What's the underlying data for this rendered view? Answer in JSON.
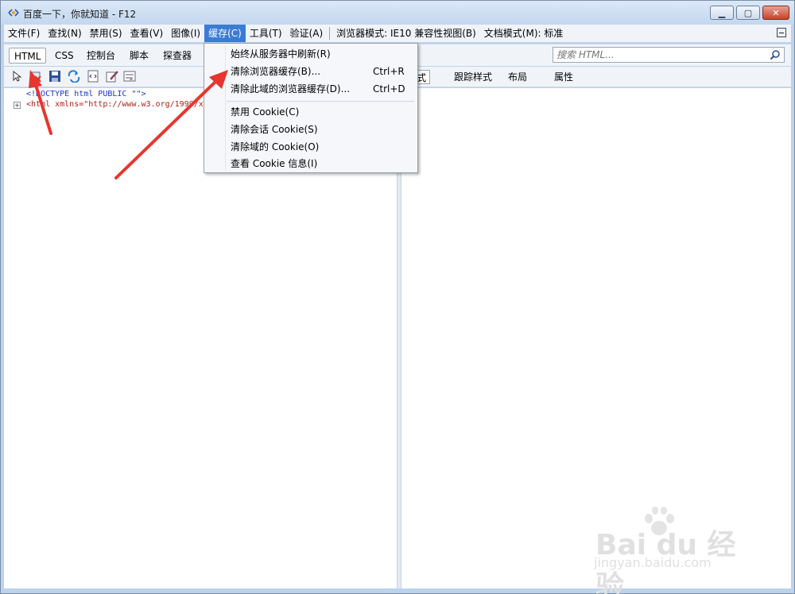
{
  "window": {
    "title": "百度一下，你就知道 - F12",
    "minimize_glyph": "▁",
    "maximize_glyph": "▢",
    "close_glyph": "✕"
  },
  "menubar": {
    "items": [
      "文件(F)",
      "查找(N)",
      "禁用(S)",
      "查看(V)",
      "图像(I)",
      "缓存(C)",
      "工具(T)",
      "验证(A)"
    ],
    "browser_mode": "浏览器模式: IE10 兼容性视图(B)",
    "document_mode": "文档模式(M): 标准"
  },
  "tabs": [
    "HTML",
    "CSS",
    "控制台",
    "脚本",
    "探查器"
  ],
  "search": {
    "placeholder": "搜索 HTML..."
  },
  "right_tabs": [
    "式",
    "跟踪样式",
    "布局",
    "属性"
  ],
  "tree": {
    "doctype": "<!DOCTYPE html PUBLIC \"\">",
    "html_line": "<html xmlns=\"http://www.w3.org/1999/x"
  },
  "cache_menu": {
    "items": [
      {
        "label": "始终从服务器中刷新(R)",
        "shortcut": ""
      },
      {
        "label": "清除浏览器缓存(B)...",
        "shortcut": "Ctrl+R"
      },
      {
        "label": "清除此域的浏览器缓存(D)...",
        "shortcut": "Ctrl+D"
      },
      {
        "label": "禁用 Cookie(C)",
        "shortcut": ""
      },
      {
        "label": "清除会话 Cookie(S)",
        "shortcut": ""
      },
      {
        "label": "清除域的 Cookie(O)",
        "shortcut": ""
      },
      {
        "label": "查看 Cookie 信息(I)",
        "shortcut": ""
      }
    ]
  },
  "watermark": {
    "logo": "Bai du 经验",
    "url": "jingyan.baidu.com"
  },
  "colors": {
    "arrow": "#e8352e",
    "accent": "#3a7bd5"
  }
}
